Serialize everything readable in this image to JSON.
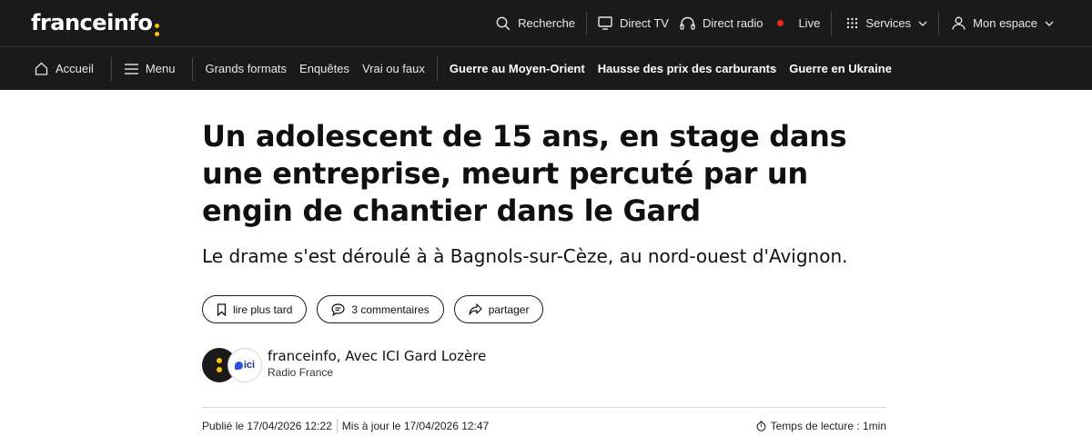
{
  "header": {
    "logo": "franceinfo",
    "nav": {
      "search": "Recherche",
      "direct_tv": "Direct TV",
      "direct_radio": "Direct radio",
      "live": "Live",
      "services": "Services",
      "account": "Mon espace"
    },
    "colors": {
      "background": "#1a1a1a",
      "accent": "#fdc400",
      "live": "#e52b2b"
    }
  },
  "subnav": {
    "home": "Accueil",
    "menu": "Menu",
    "links": [
      "Grands formats",
      "Enquêtes",
      "Vrai ou faux"
    ],
    "hot_topics": [
      "Guerre au Moyen-Orient",
      "Hausse des prix des carburants",
      "Guerre en Ukraine"
    ]
  },
  "article": {
    "title": "Un adolescent de 15 ans, en stage dans une entreprise, meurt percuté par un engin de chantier dans le Gard",
    "chapo": "Le drame s'est déroulé à à Bagnols-sur-Cèze, au nord-ouest d'Avignon.",
    "actions": {
      "read_later": "lire plus tard",
      "comments": "3 commentaires",
      "share": "partager"
    },
    "author": {
      "name": "franceinfo, Avec ICI Gard Lozère",
      "org": "Radio France",
      "partner_logo": "ici"
    },
    "meta": {
      "published": "Publié le 17/04/2026 12:22",
      "updated": "Mis à jour le 17/04/2026 12:47",
      "reading_time": "Temps de lecture : 1min"
    }
  }
}
